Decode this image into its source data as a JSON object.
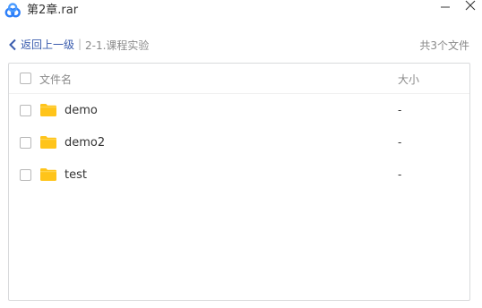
{
  "window": {
    "title": "第2章.rar",
    "icon": "baidu-netdisk-cloud-icon"
  },
  "nav": {
    "back_label": "返回上一级",
    "separator": "|",
    "current_path": "2-1.课程实验",
    "file_count": "共3个文件"
  },
  "table": {
    "columns": {
      "name": "文件名",
      "size": "大小"
    },
    "rows": [
      {
        "name": "demo",
        "size": "-"
      },
      {
        "name": "demo2",
        "size": "-"
      },
      {
        "name": "test",
        "size": "-"
      }
    ]
  },
  "colors": {
    "accent": "#3a5cae",
    "folder": "#ffc41a",
    "logo_blue": "#2d7ff9",
    "border": "#d9dadc",
    "muted_text": "#8a8a8a"
  }
}
